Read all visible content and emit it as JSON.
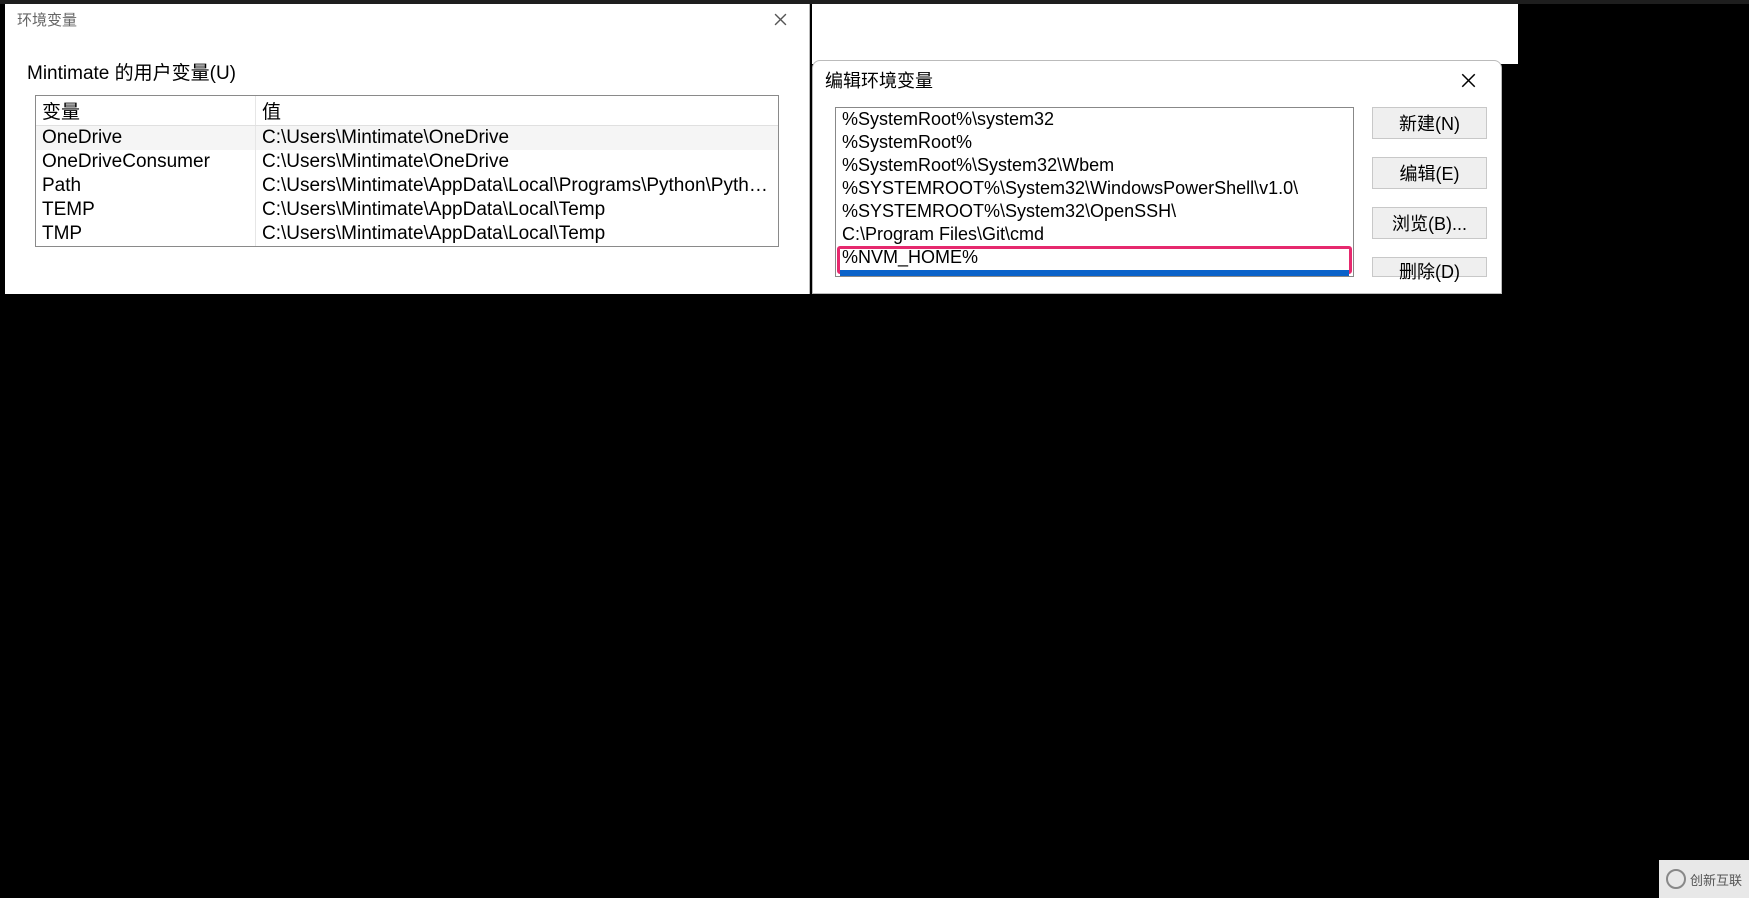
{
  "left_dialog": {
    "title": "环境变量",
    "section_label": "Mintimate 的用户变量(U)",
    "columns": {
      "c1": "变量",
      "c2": "值"
    },
    "rows": [
      {
        "var": "OneDrive",
        "val": "C:\\Users\\Mintimate\\OneDrive"
      },
      {
        "var": "OneDriveConsumer",
        "val": "C:\\Users\\Mintimate\\OneDrive"
      },
      {
        "var": "Path",
        "val": "C:\\Users\\Mintimate\\AppData\\Local\\Programs\\Python\\Python3..."
      },
      {
        "var": "TEMP",
        "val": "C:\\Users\\Mintimate\\AppData\\Local\\Temp"
      },
      {
        "var": "TMP",
        "val": "C:\\Users\\Mintimate\\AppData\\Local\\Temp"
      }
    ]
  },
  "right_dialog": {
    "title": "编辑环境变量",
    "path_items": [
      "%SystemRoot%\\system32",
      "%SystemRoot%",
      "%SystemRoot%\\System32\\Wbem",
      "%SYSTEMROOT%\\System32\\WindowsPowerShell\\v1.0\\",
      "%SYSTEMROOT%\\System32\\OpenSSH\\",
      "C:\\Program Files\\Git\\cmd",
      "%NVM_HOME%"
    ],
    "buttons": {
      "new": "新建(N)",
      "edit": "编辑(E)",
      "browse": "浏览(B)...",
      "delete": "删除(D)"
    }
  },
  "watermark": "创新互联"
}
